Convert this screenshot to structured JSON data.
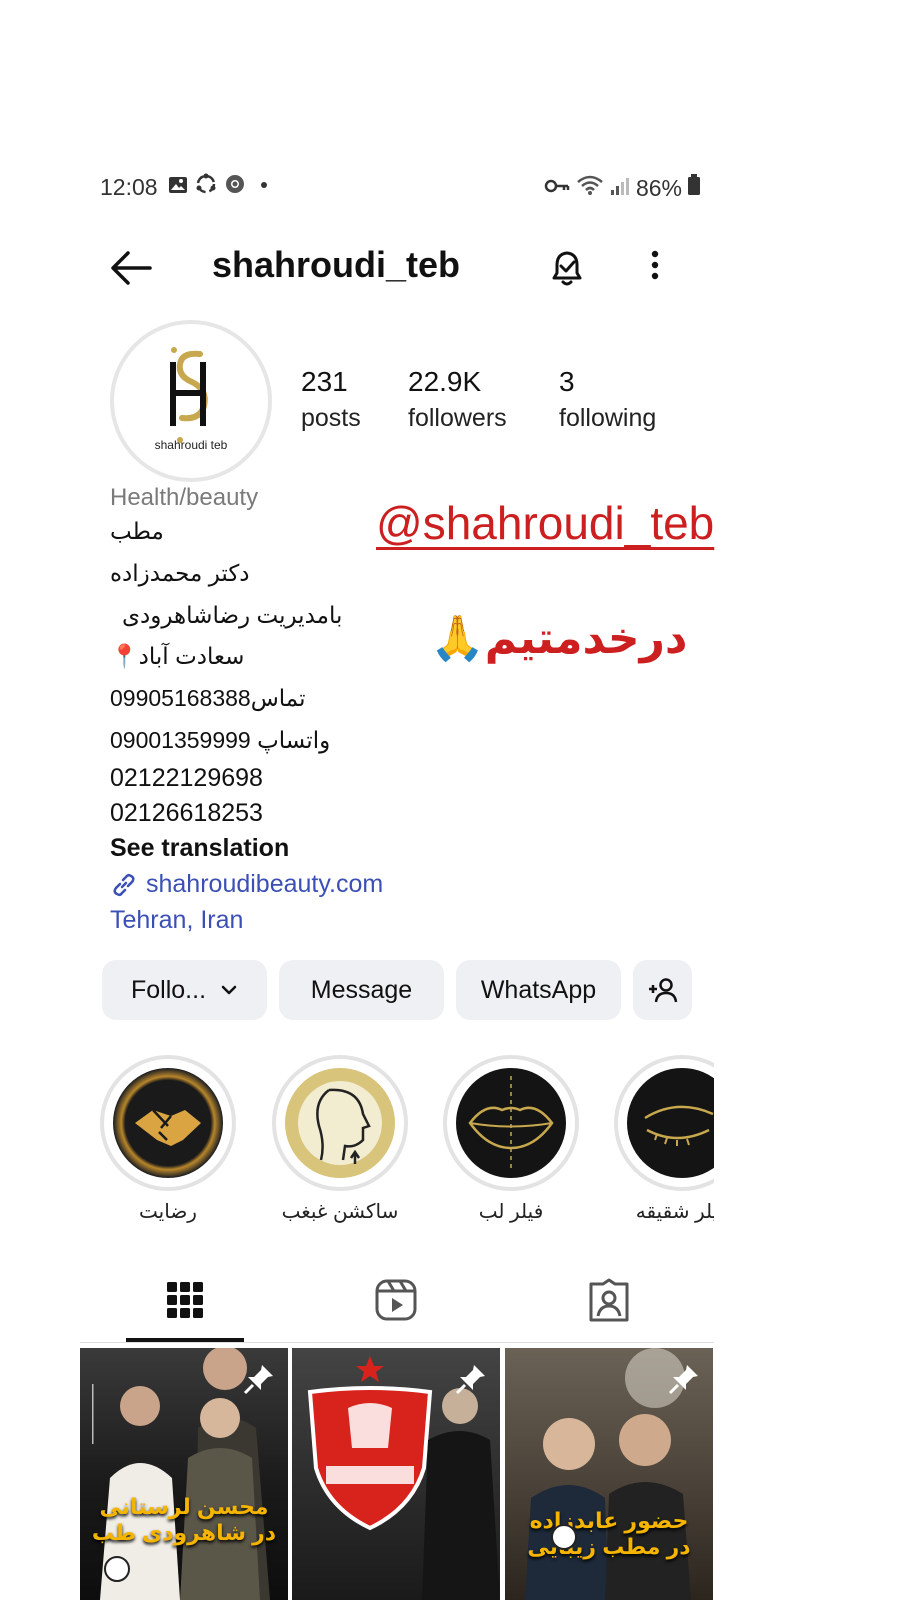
{
  "status_bar": {
    "time": "12:08",
    "battery": "86%",
    "left_icons": [
      "image-icon",
      "sync-icon",
      "chrome-icon",
      "dot-icon"
    ],
    "right_icons": [
      "vpn-key-icon",
      "wifi-icon",
      "signal-icon",
      "battery-icon"
    ]
  },
  "header": {
    "username": "shahroudi_teb"
  },
  "profile": {
    "avatar_caption": "shahroudi teb",
    "stats": [
      {
        "value": "231",
        "label": "posts"
      },
      {
        "value": "22.9K",
        "label": "followers"
      },
      {
        "value": "3",
        "label": "following"
      }
    ],
    "category": "Health/beauty",
    "bio_lines": [
      "مطب",
      "دکتر محمدزاده",
      "بامدیریت رضاشاهرودی",
      "سعادت آباد📍",
      "تماس09905168388",
      "واتساپ 09001359999",
      "02122129698",
      "02126618253"
    ],
    "overlay_handle": "@shahroudi_teb",
    "overlay_text": "درخدمتیم🙏",
    "see_translation": "See translation",
    "link": "shahroudibeauty.com",
    "location": "Tehran, Iran"
  },
  "actions": {
    "follow": "Follo...",
    "message": "Message",
    "whatsapp": "WhatsApp"
  },
  "highlights": [
    {
      "label": "رضایت",
      "icon": "handshake-icon"
    },
    {
      "label": "ساکشن غبغب",
      "icon": "face-profile-icon"
    },
    {
      "label": "فیلر لب",
      "icon": "lips-icon"
    },
    {
      "label": "فیلر شقیقه",
      "icon": "eye-icon"
    }
  ],
  "tabs": [
    "grid-icon",
    "reels-icon",
    "tagged-icon"
  ],
  "posts": [
    {
      "caption": "محسن لرستانی در شاهرودی طب"
    },
    {
      "caption": ""
    },
    {
      "caption": "حضور عابدزاده در مطب زیبایی"
    }
  ],
  "colors": {
    "accent_red": "#cc1f1f",
    "link_blue": "#3b4fb5",
    "button_bg": "#eef0f4",
    "gold": "#c8a84e"
  }
}
